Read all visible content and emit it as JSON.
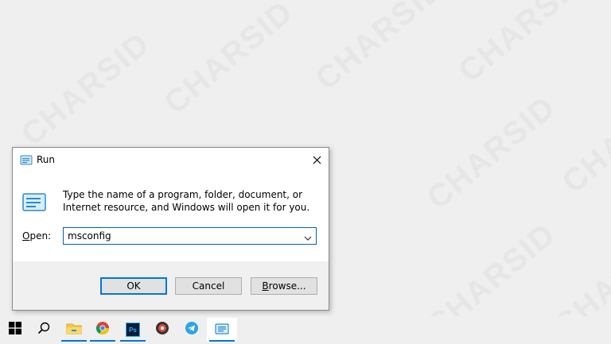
{
  "watermark": "CHARSID",
  "dialog": {
    "title": "Run",
    "description": "Type the name of a program, folder, document, or Internet resource, and Windows will open it for you.",
    "open_label_mnemonic": "O",
    "open_label_rest": "pen:",
    "open_value": "msconfig",
    "buttons": {
      "ok": "OK",
      "cancel": "Cancel",
      "browse_mnemonic": "B",
      "browse_rest": "rowse..."
    }
  },
  "taskbar": {
    "items": [
      {
        "icon": "windows-start-icon"
      },
      {
        "icon": "search-icon"
      },
      {
        "icon": "file-explorer-icon"
      },
      {
        "icon": "chrome-icon"
      },
      {
        "icon": "photoshop-icon",
        "label": "Ps"
      },
      {
        "icon": "media-player-icon"
      },
      {
        "icon": "telegram-icon"
      },
      {
        "icon": "run-app-icon"
      }
    ]
  },
  "colors": {
    "accent": "#0078d7",
    "background": "#efefef",
    "footer": "#f0f0f0"
  }
}
